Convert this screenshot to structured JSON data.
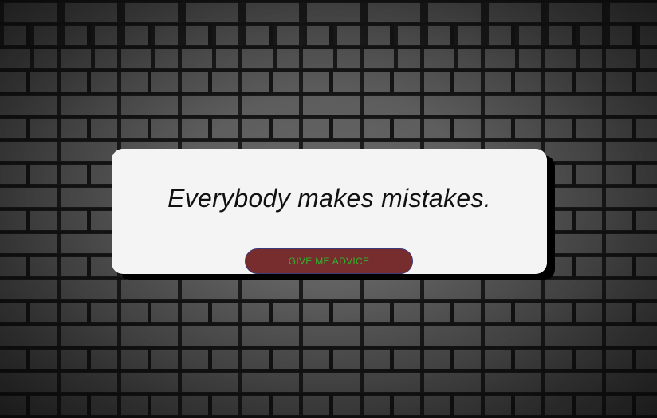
{
  "quote": {
    "text": "Everybody makes mistakes."
  },
  "button": {
    "label": "GIVE ME ADVICE"
  },
  "colors": {
    "button_bg": "#772d2d",
    "button_text": "#2fb52f",
    "card_bg": "#f4f4f4"
  },
  "background": {
    "image": "brick-wall"
  }
}
